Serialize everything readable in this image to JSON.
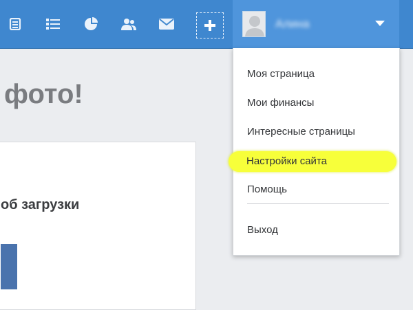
{
  "header": {
    "icons": [
      "document-list-icon",
      "list-icon",
      "pie-chart-icon",
      "people-icon",
      "mail-icon"
    ],
    "add_icon": "plus-icon",
    "user": {
      "name": "Алина",
      "avatar_icon": "user-avatar-icon",
      "menu_icon": "chevron-down-icon"
    }
  },
  "main": {
    "title": "фото!",
    "card": {
      "heading": "об загрузки"
    }
  },
  "menu": {
    "items": [
      {
        "label": "Моя страница"
      },
      {
        "label": "Мои финансы"
      },
      {
        "label": "Интересные страницы"
      },
      {
        "label": "Настройки сайта",
        "highlighted": true
      },
      {
        "label": "Помощь"
      },
      {
        "label": "Выход"
      }
    ],
    "highlight_color": "#f7ff3a"
  },
  "colors": {
    "header": "#3f87cf",
    "menu_bg": "#ffffff"
  }
}
